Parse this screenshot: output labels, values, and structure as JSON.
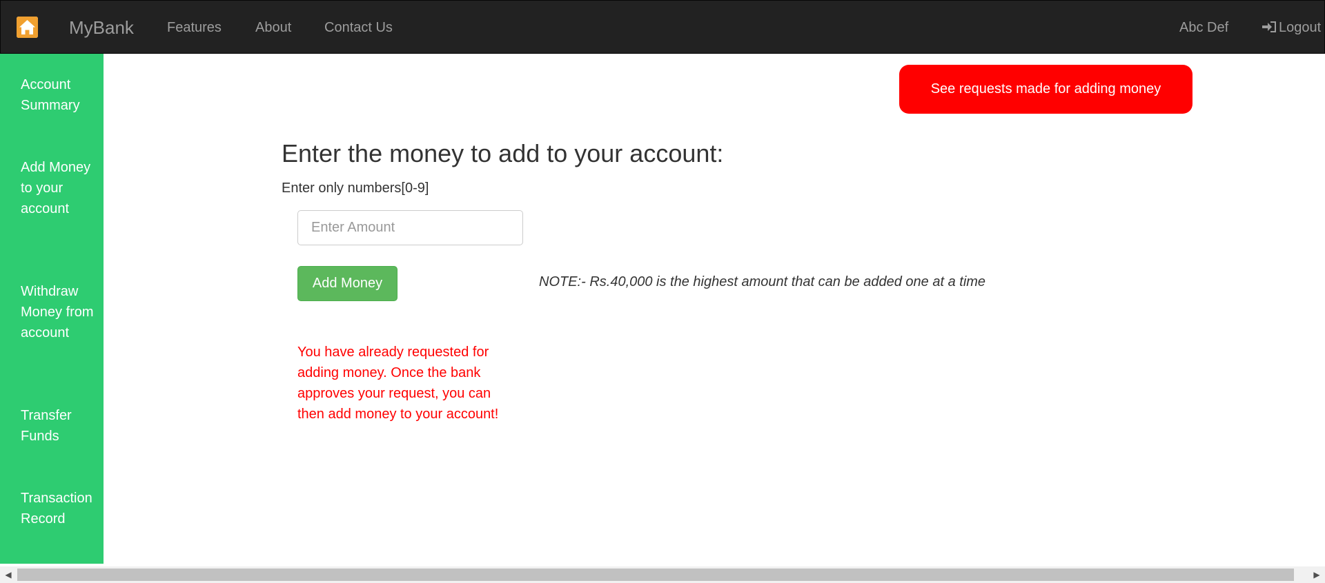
{
  "navbar": {
    "brand": "MyBank",
    "links": [
      "Features",
      "About",
      "Contact Us"
    ],
    "user_name": "Abc Def",
    "logout_label": "Logout"
  },
  "sidebar": {
    "items": [
      {
        "label": "Account Summary"
      },
      {
        "label": "Add Money to your account"
      },
      {
        "label": "Withdraw Money from account"
      },
      {
        "label": "Transfer Funds"
      },
      {
        "label": "Transaction Record"
      }
    ]
  },
  "main": {
    "requests_button": "See requests made for adding money",
    "title": "Enter the money to add to your account:",
    "hint": "Enter only numbers[0-9]",
    "amount_placeholder": "Enter Amount",
    "add_button": "Add Money",
    "note": "NOTE:- Rs.40,000 is the highest amount that can be added one at a time",
    "error_message": "You have already requested for adding money. Once the bank approves your request, you can then add money to your account!"
  },
  "colors": {
    "navbar_bg": "#222222",
    "sidebar_bg": "#2ecc71",
    "requests_button_bg": "#ff0000",
    "add_button_bg": "#5cb85c",
    "error_text": "#ff0000"
  },
  "icons": {
    "brand_logo": "home-icon",
    "logout": "logout-icon"
  }
}
